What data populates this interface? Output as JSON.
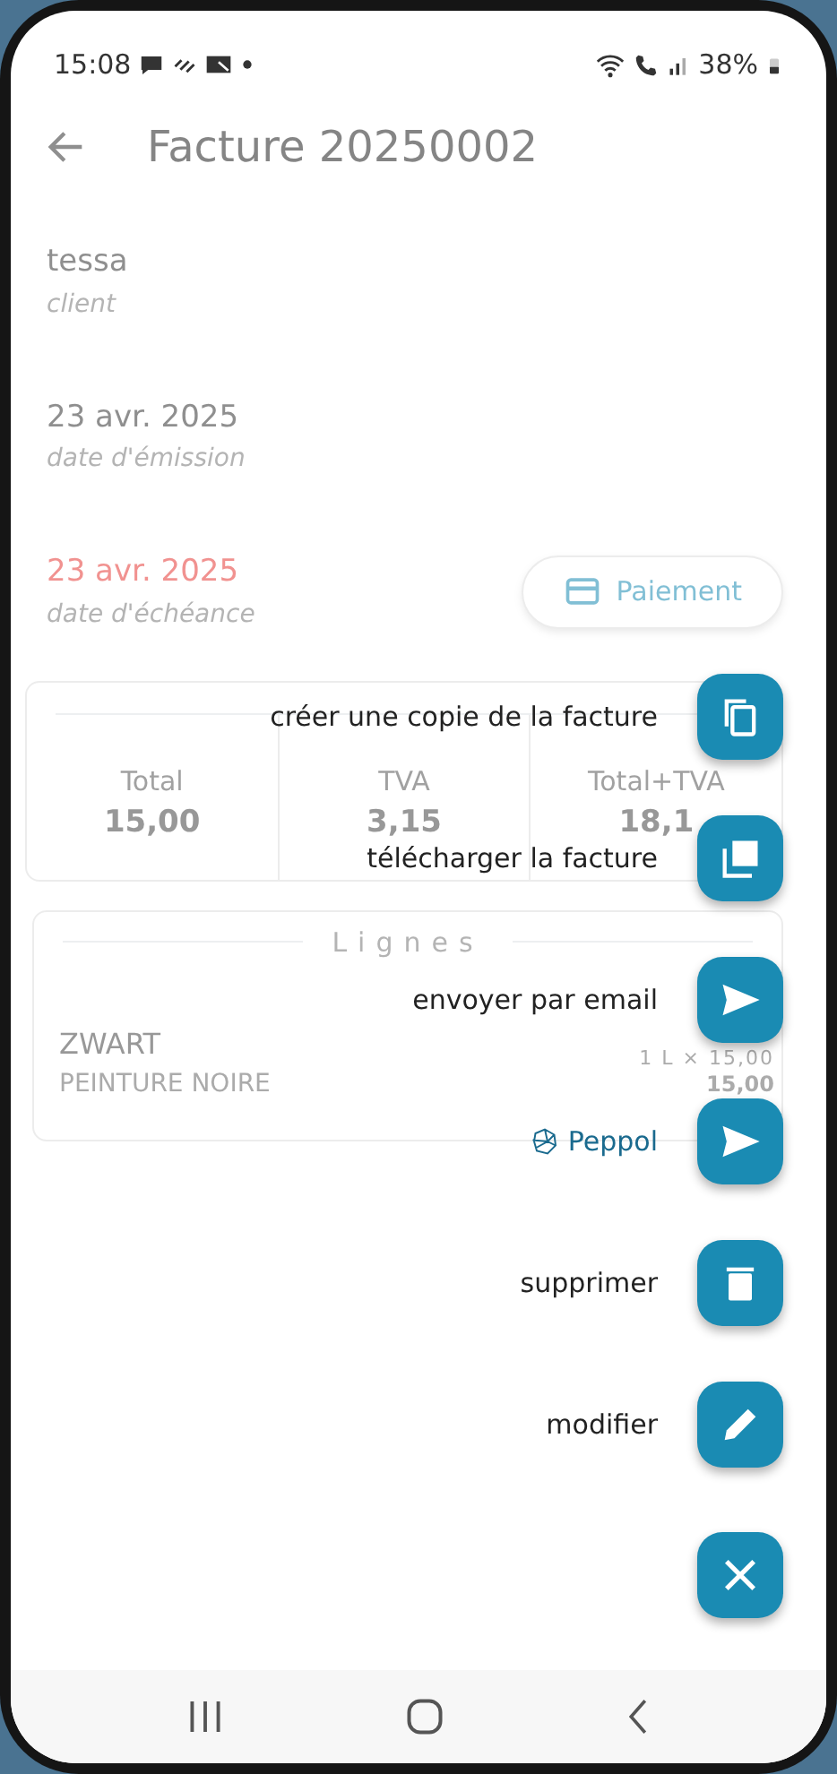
{
  "status_bar": {
    "time": "15:08",
    "battery": "38%"
  },
  "app_bar": {
    "title": "Facture 20250002"
  },
  "fields": [
    {
      "value": "tessa",
      "label": "client",
      "overdue": false
    },
    {
      "value": "23 avr. 2025",
      "label": "date d'émission",
      "overdue": false
    },
    {
      "value": "23 avr. 2025",
      "label": "date d'échéance",
      "overdue": true
    }
  ],
  "payment_button": {
    "label": "Paiement"
  },
  "totals": [
    {
      "label": "Total",
      "value": "15,00"
    },
    {
      "label": "TVA",
      "value": "3,15"
    },
    {
      "label": "Total+TVA",
      "value": "18,1"
    }
  ],
  "lines_section": {
    "title": "Lignes",
    "items": [
      {
        "name": "ZWART",
        "description": "PEINTURE NOIRE",
        "quantity": "1 L × 15,00",
        "amount": "15,00"
      }
    ]
  },
  "menu": {
    "open": true,
    "items": [
      {
        "label": "créer une copie de la facture",
        "kind": "text"
      },
      {
        "label": "télécharger la facture",
        "kind": "text"
      },
      {
        "label": "envoyer par email",
        "kind": "text"
      },
      {
        "label": "Peppol",
        "kind": "logo"
      },
      {
        "label": "supprimer",
        "kind": "text"
      },
      {
        "label": "modifier",
        "kind": "text"
      }
    ]
  }
}
